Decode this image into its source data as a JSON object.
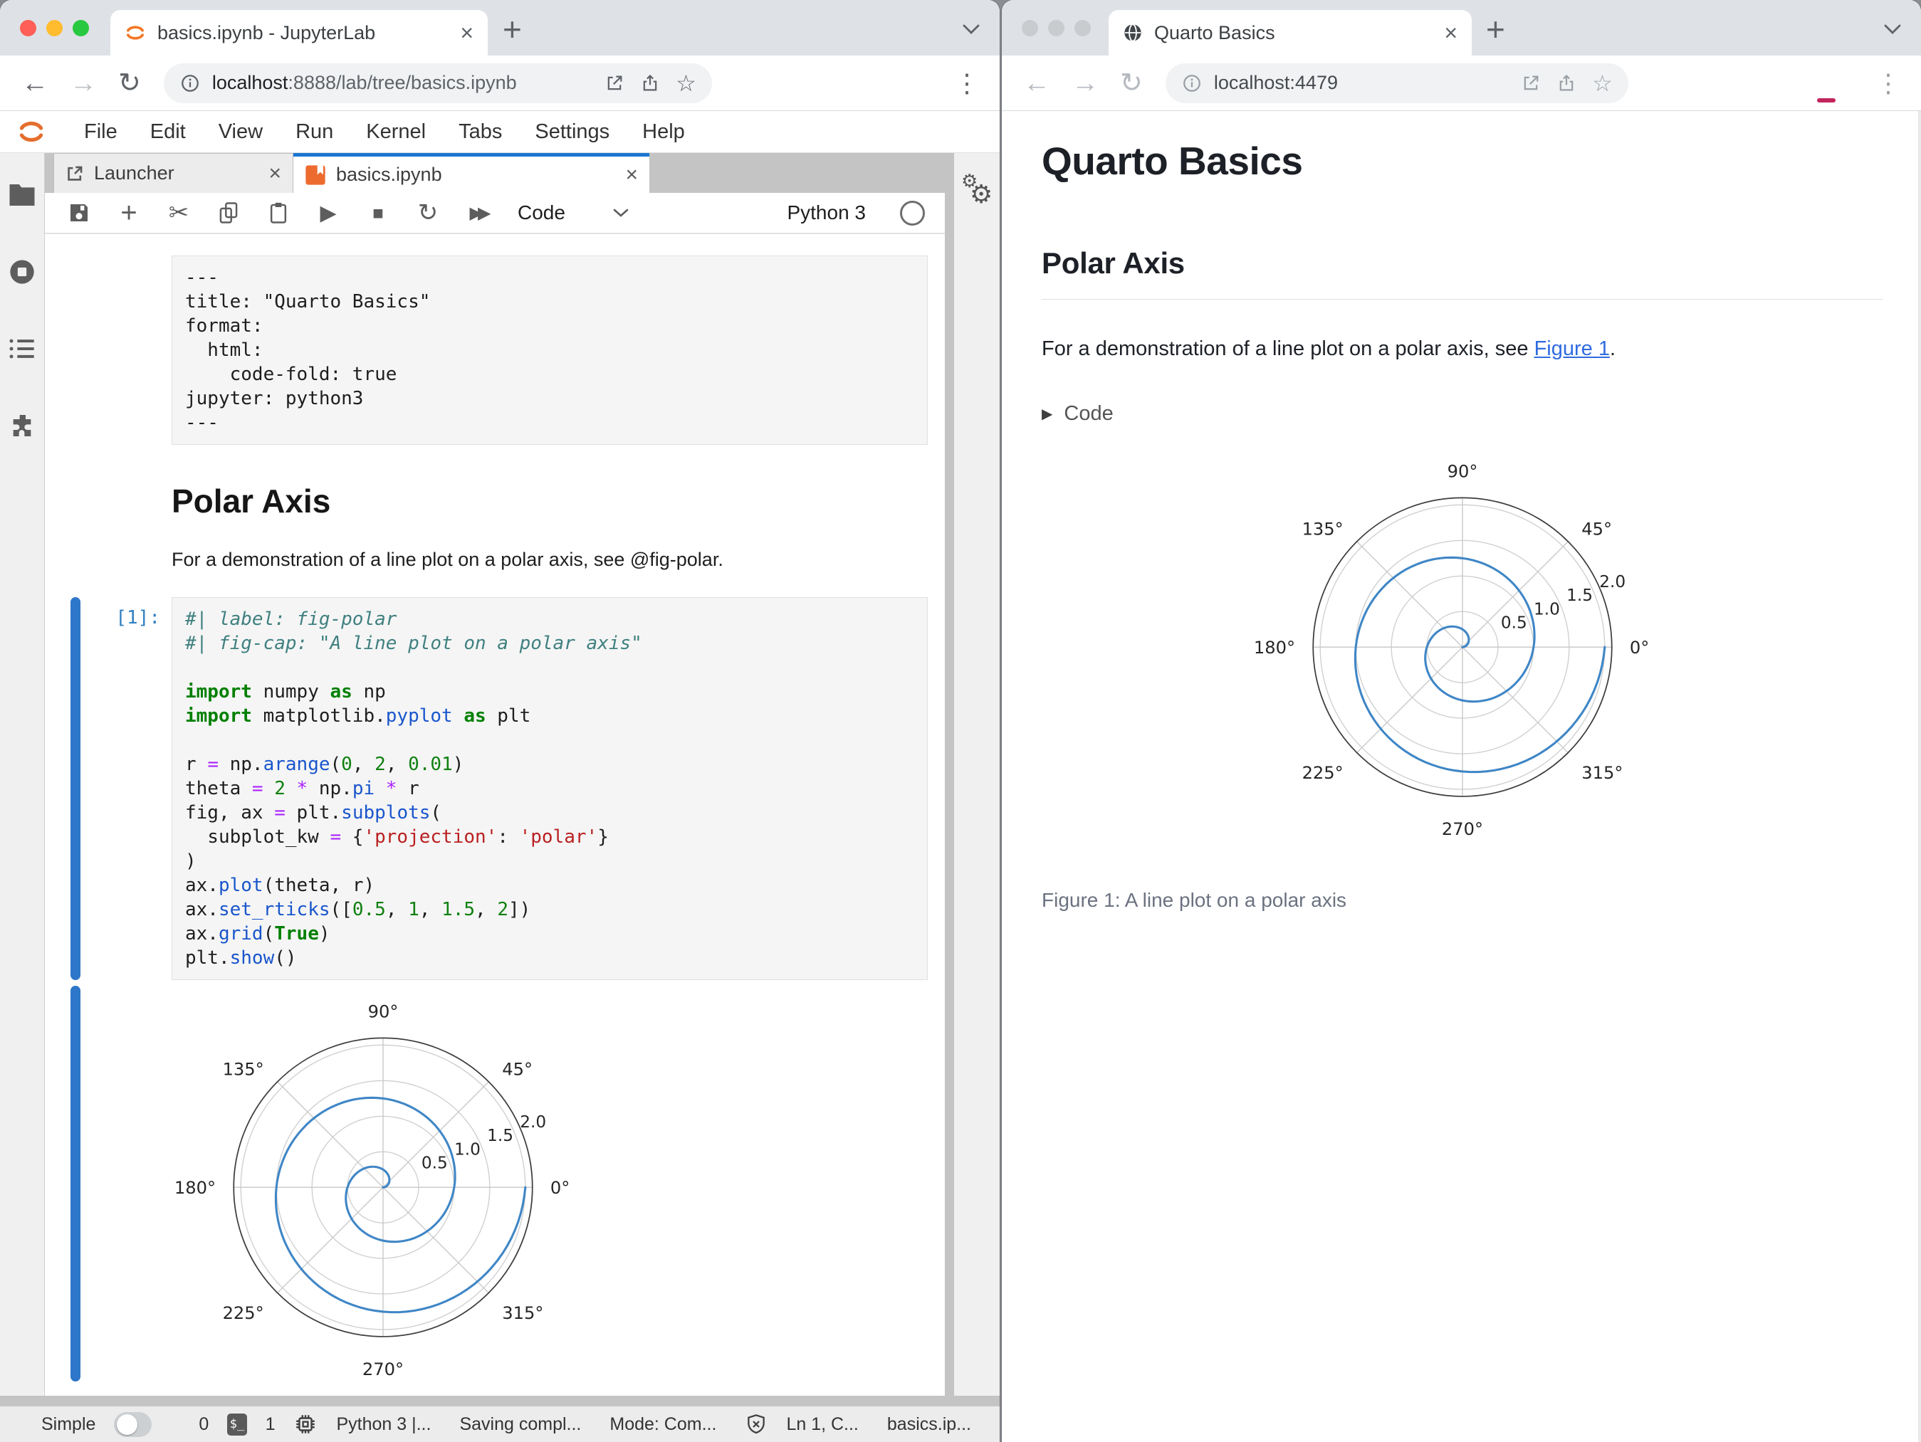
{
  "left_window": {
    "tab_title": "basics.ipynb - JupyterLab",
    "url_host": "localhost",
    "url_rest": ":8888/lab/tree/basics.ipynb",
    "menu": [
      "File",
      "Edit",
      "View",
      "Run",
      "Kernel",
      "Tabs",
      "Settings",
      "Help"
    ],
    "dock_tabs": {
      "launcher": "Launcher",
      "notebook": "basics.ipynb"
    },
    "toolbar": {
      "cell_type": "Code",
      "kernel": "Python 3"
    },
    "statusbar": {
      "mode_toggle_label": "Simple",
      "terminals_count": "0",
      "kernels_count": "1",
      "kernel_status": "Python 3 |...",
      "saving_status": "Saving compl...",
      "mode": "Mode: Com...",
      "cursor_position": "Ln 1, C...",
      "file_name": "basics.ip..."
    },
    "notebook": {
      "raw_lines": [
        "---",
        "title: \"Quarto Basics\"",
        "format:",
        "  html:",
        "    code-fold: true",
        "jupyter: python3",
        "---"
      ],
      "heading": "Polar Axis",
      "paragraph": "For a demonstration of a line plot on a polar axis, see @fig-polar.",
      "prompt": "[1]:",
      "code_tokens": [
        [
          [
            "com",
            "#| label: fig-polar"
          ]
        ],
        [
          [
            "com",
            "#| fig-cap: \"A line plot on a polar axis\""
          ]
        ],
        [],
        [
          [
            "kw",
            "import"
          ],
          [
            "pl",
            " numpy "
          ],
          [
            "kw",
            "as"
          ],
          [
            "pl",
            " np"
          ]
        ],
        [
          [
            "kw",
            "import"
          ],
          [
            "pl",
            " matplotlib."
          ],
          [
            "fn",
            "pyplot"
          ],
          [
            "pl",
            " "
          ],
          [
            "kw",
            "as"
          ],
          [
            "pl",
            " plt"
          ]
        ],
        [],
        [
          [
            "pl",
            "r "
          ],
          [
            "op",
            "="
          ],
          [
            "pl",
            " np."
          ],
          [
            "fn",
            "arange"
          ],
          [
            "pl",
            "("
          ],
          [
            "num",
            "0"
          ],
          [
            "pl",
            ", "
          ],
          [
            "num",
            "2"
          ],
          [
            "pl",
            ", "
          ],
          [
            "num",
            "0.01"
          ],
          [
            "pl",
            ")"
          ]
        ],
        [
          [
            "pl",
            "theta "
          ],
          [
            "op",
            "="
          ],
          [
            "pl",
            " "
          ],
          [
            "num",
            "2"
          ],
          [
            "pl",
            " "
          ],
          [
            "op",
            "*"
          ],
          [
            "pl",
            " np."
          ],
          [
            "fn",
            "pi"
          ],
          [
            "pl",
            " "
          ],
          [
            "op",
            "*"
          ],
          [
            "pl",
            " r"
          ]
        ],
        [
          [
            "pl",
            "fig, ax "
          ],
          [
            "op",
            "="
          ],
          [
            "pl",
            " plt."
          ],
          [
            "fn",
            "subplots"
          ],
          [
            "pl",
            "("
          ]
        ],
        [
          [
            "pl",
            "  subplot_kw "
          ],
          [
            "op",
            "="
          ],
          [
            "pl",
            " {"
          ],
          [
            "str",
            "'projection'"
          ],
          [
            "pl",
            ": "
          ],
          [
            "str",
            "'polar'"
          ],
          [
            "pl",
            "}"
          ]
        ],
        [
          [
            "pl",
            ")"
          ]
        ],
        [
          [
            "pl",
            "ax."
          ],
          [
            "fn",
            "plot"
          ],
          [
            "pl",
            "(theta, r)"
          ]
        ],
        [
          [
            "pl",
            "ax."
          ],
          [
            "fn",
            "set_rticks"
          ],
          [
            "pl",
            "(["
          ],
          [
            "num",
            "0.5"
          ],
          [
            "pl",
            ", "
          ],
          [
            "num",
            "1"
          ],
          [
            "pl",
            ", "
          ],
          [
            "num",
            "1.5"
          ],
          [
            "pl",
            ", "
          ],
          [
            "num",
            "2"
          ],
          [
            "pl",
            "])"
          ]
        ],
        [
          [
            "pl",
            "ax."
          ],
          [
            "fn",
            "grid"
          ],
          [
            "pl",
            "("
          ],
          [
            "kw",
            "True"
          ],
          [
            "pl",
            ")"
          ]
        ],
        [
          [
            "pl",
            "plt."
          ],
          [
            "fn",
            "show"
          ],
          [
            "pl",
            "()"
          ]
        ]
      ]
    }
  },
  "right_window": {
    "tab_title": "Quarto Basics",
    "url": "localhost:4479",
    "page": {
      "title": "Quarto Basics",
      "section": "Polar Axis",
      "para_before": "For a demonstration of a line plot on a polar axis, see ",
      "para_link": "Figure 1",
      "para_after": ".",
      "code_fold_label": "Code",
      "caption": "Figure 1: A line plot on a polar axis"
    }
  },
  "icons": {
    "close_tab": "×",
    "new_tab": "+",
    "back": "←",
    "forward": "→",
    "reload": "↻",
    "star": "☆",
    "overflow": "⋮",
    "play": "▶",
    "stop": "■",
    "cut": "✂",
    "fast_forward": "▶▶",
    "gear": "⚙",
    "fold_triangle": "▶",
    "terminal_badge": "$_"
  },
  "colors": {
    "accent_blue": "#1976d2",
    "jupyter_orange": "#f37726",
    "link": "#2f6be0",
    "spiral_line": "#3f86c6",
    "prompt_blue": "#307fc1",
    "traffic_red": "#ff5f57",
    "traffic_yellow": "#febc2e",
    "traffic_green": "#28c840"
  },
  "chart_data": {
    "type": "line",
    "projection": "polar",
    "title": "A line plot on a polar axis",
    "r_start": 0,
    "r_end": 2,
    "r_step": 0.01,
    "theta_formula": "theta = 2 * pi * r",
    "theta_ticks_deg": [
      0,
      45,
      90,
      135,
      180,
      225,
      270,
      315
    ],
    "theta_tick_labels": [
      "0°",
      "45°",
      "90°",
      "135°",
      "180°",
      "225°",
      "270°",
      "315°"
    ],
    "rticks": [
      0.5,
      1.0,
      1.5,
      2.0
    ],
    "rtick_labels": [
      "0.5",
      "1.0",
      "1.5",
      "2.0"
    ],
    "rlabel_angle_deg": 22.5,
    "rmax_display": 2.1,
    "grid": true,
    "line_color": "#3f86c6",
    "instances": [
      "jupyter-notebook-output",
      "quarto-page-figure"
    ]
  }
}
